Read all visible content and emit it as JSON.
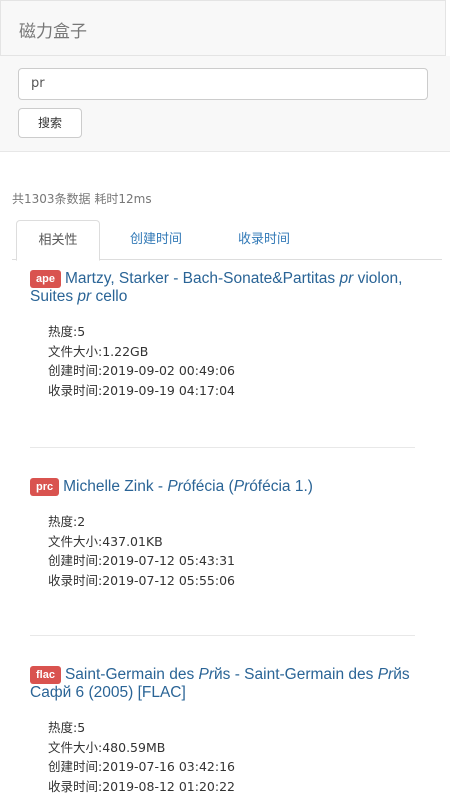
{
  "header": {
    "brand": "磁力盒子"
  },
  "search": {
    "value": "pr",
    "button_label": "搜索"
  },
  "stats": "共1303条数据 耗时12ms",
  "tabs": [
    {
      "label": "相关性",
      "active": true
    },
    {
      "label": "创建时间",
      "active": false
    },
    {
      "label": "收录时间",
      "active": false
    }
  ],
  "results": [
    {
      "badge": "ape",
      "title_parts": [
        "Martzy, Starker - Bach-Sonate&Partitas ",
        "pr",
        " violon, Suites ",
        "pr",
        " cello"
      ],
      "heat": "热度:5",
      "size": "文件大小:1.22GB",
      "created": "创建时间:2019-09-02 00:49:06",
      "indexed": "收录时间:2019-09-19 04:17:04"
    },
    {
      "badge": "prc",
      "title_parts": [
        "Michelle Zink - ",
        "Pr",
        "ófécia (",
        "Pr",
        "ófécia 1.)"
      ],
      "heat": "热度:2",
      "size": "文件大小:437.01KB",
      "created": "创建时间:2019-07-12 05:43:31",
      "indexed": "收录时间:2019-07-12 05:55:06"
    },
    {
      "badge": "flac",
      "title_parts": [
        "Saint-Germain des ",
        "Pr",
        "йs - Saint-Germain des ",
        "Pr",
        "йs Cафй 6 (2005) [FLAC]"
      ],
      "heat": "热度:5",
      "size": "文件大小:480.59MB",
      "created": "创建时间:2019-07-16 03:42:16",
      "indexed": "收录时间:2019-08-12 01:20:22"
    }
  ]
}
